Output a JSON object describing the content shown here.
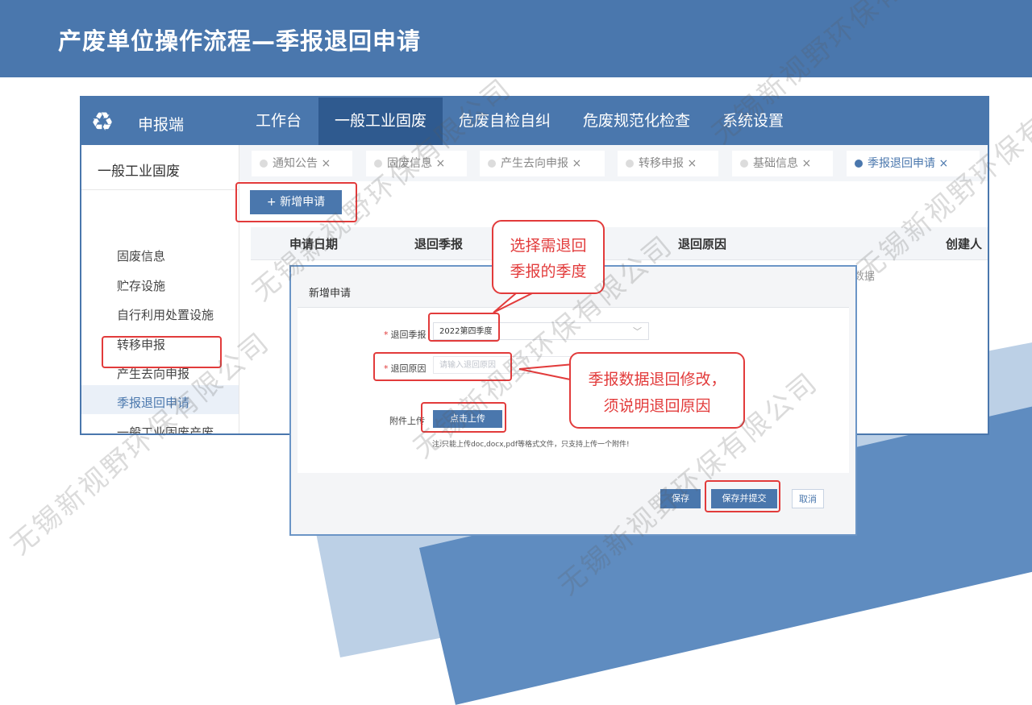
{
  "slide": {
    "title": "产废单位操作流程—季报退回申请"
  },
  "app": {
    "brand": "申报端",
    "nav": [
      "工作台",
      "一般工业固废",
      "危废自检自纠",
      "危废规范化检查",
      "系统设置"
    ],
    "active_nav": "一般工业固废",
    "sidebar": {
      "title": "一般工业固废",
      "items": [
        "固废信息",
        "贮存设施",
        "自行利用处置设施",
        "转移申报",
        "产生去向申报",
        "季报退回申请",
        "一般工业固废产废..."
      ],
      "active": "季报退回申请"
    },
    "tabs": [
      {
        "label": "通知公告",
        "close": "×"
      },
      {
        "label": "固废信息",
        "close": "×"
      },
      {
        "label": "产生去向申报",
        "close": "×"
      },
      {
        "label": "转移申报",
        "close": "×"
      },
      {
        "label": "基础信息",
        "close": "×"
      },
      {
        "label": "季报退回申请",
        "close": "×",
        "active": true
      }
    ],
    "add_button": "+ 新增申请",
    "table": {
      "headers": [
        "申请日期",
        "退回季报",
        "退回原因",
        "创建人"
      ],
      "empty_text": "数据"
    }
  },
  "dialog": {
    "title": "新增申请",
    "quarter_label": "退回季报",
    "quarter_value": "2022第四季度",
    "reason_label": "退回原因",
    "reason_placeholder": "请输入退回原因",
    "attachment_label": "附件上传",
    "upload_button": "点击上传",
    "upload_note": "注:只能上传doc,docx,pdf等格式文件，只支持上传一个附件!",
    "save_button": "保存",
    "submit_button": "保存并提交",
    "cancel_button": "取消"
  },
  "callouts": {
    "select_quarter": [
      "选择需退回",
      "季报的季度"
    ],
    "reason": [
      "季报数据退回修改，",
      "须说明退回原因"
    ]
  },
  "watermark": "无锡新视野环保有限公司",
  "colors": {
    "header": "#4a77ad",
    "highlight": "#e23b3b",
    "accent": "#4a77ad"
  }
}
